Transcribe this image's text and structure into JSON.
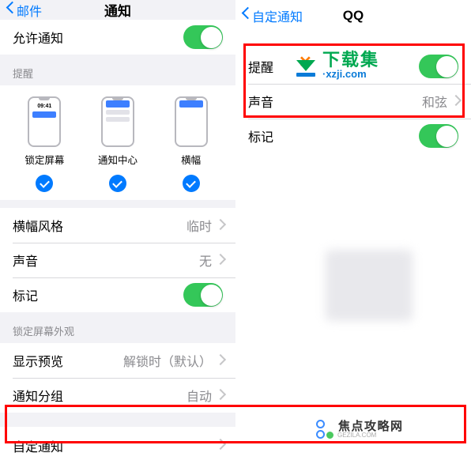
{
  "left": {
    "nav": {
      "back": "邮件",
      "title": "通知"
    },
    "allow_notifications": "允许通知",
    "section_reminders": "提醒",
    "alert_styles": {
      "lock_time": "09:41",
      "lock_screen": "锁定屏幕",
      "notification_center": "通知中心",
      "banner": "横幅"
    },
    "banner_style": {
      "label": "横幅风格",
      "value": "临时"
    },
    "sound": {
      "label": "声音",
      "value": "无"
    },
    "badge": "标记",
    "section_lockscreen": "锁定屏幕外观",
    "preview": {
      "label": "显示预览",
      "value": "解锁时（默认）"
    },
    "grouping": {
      "label": "通知分组",
      "value": "自动"
    },
    "customize": "自定通知"
  },
  "right": {
    "nav": {
      "back": "自定通知",
      "title": "QQ"
    },
    "reminder": "提醒",
    "sound": {
      "label": "声音",
      "value": "和弦"
    },
    "badge": "标记"
  },
  "watermark1": {
    "cn": "下载集",
    "en": "·xzji.com"
  },
  "watermark2": {
    "text": "焦点攻略网",
    "sub": "GEZILA.COM"
  }
}
